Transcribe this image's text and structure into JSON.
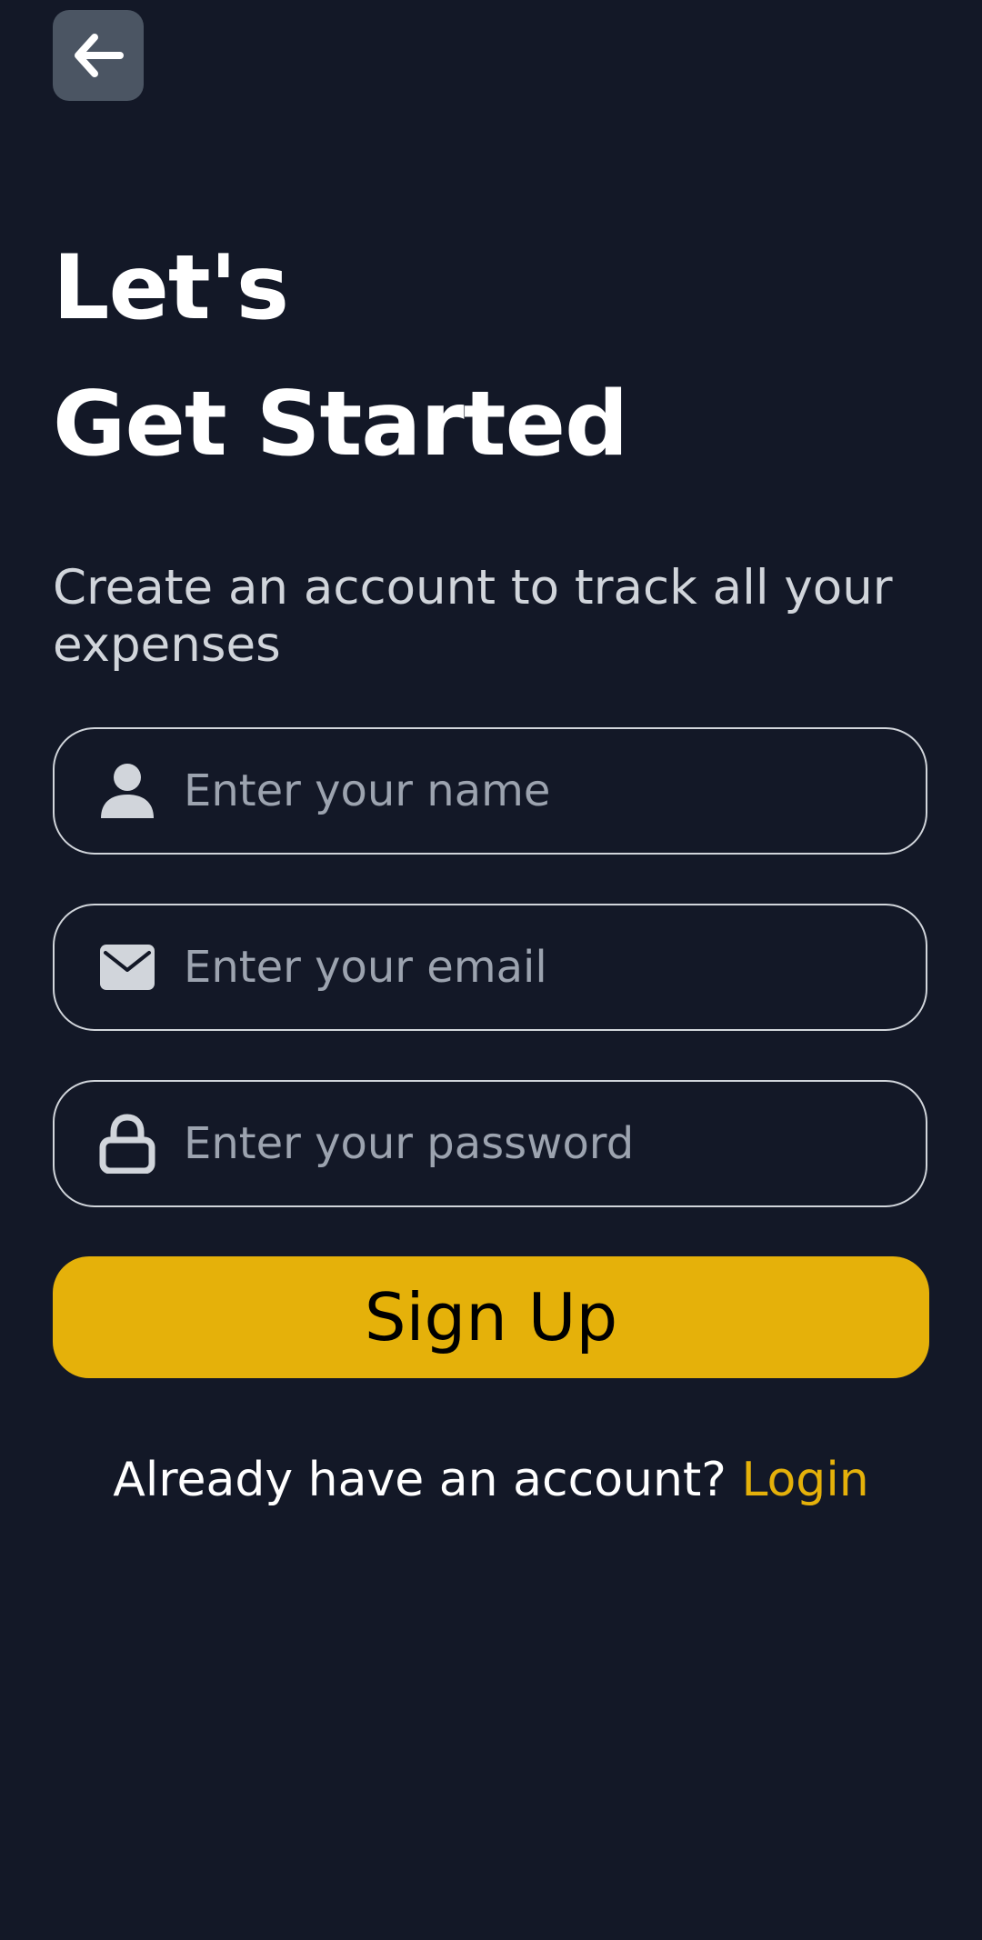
{
  "header": {
    "back_icon": "arrow-left-icon"
  },
  "title": {
    "line1": "Let's",
    "line2": "Get Started"
  },
  "subtitle": "Create an account to track all your expenses",
  "form": {
    "name": {
      "icon": "user-icon",
      "value": "",
      "placeholder": "Enter your name"
    },
    "email": {
      "icon": "envelope-icon",
      "value": "",
      "placeholder": "Enter your email"
    },
    "password": {
      "icon": "lock-icon",
      "value": "",
      "placeholder": "Enter your password"
    },
    "submit_label": "Sign Up"
  },
  "footer": {
    "prompt": "Already have an account?",
    "login_label": "Login"
  },
  "colors": {
    "background": "#131827",
    "accent": "#E5B10A",
    "field_border": "#D1D5DB",
    "placeholder": "#9CA3AF",
    "back_button_bg": "#4B5563"
  }
}
